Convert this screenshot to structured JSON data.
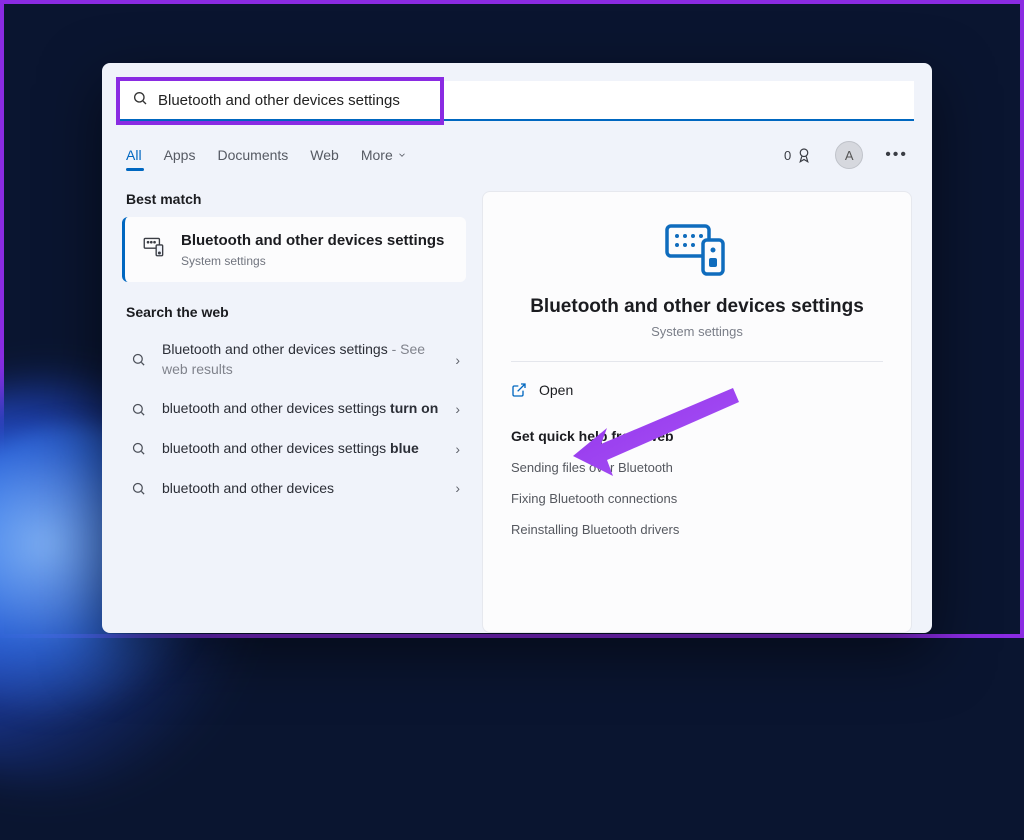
{
  "search": {
    "query": "Bluetooth and other devices settings"
  },
  "tabs": {
    "all": "All",
    "apps": "Apps",
    "documents": "Documents",
    "web": "Web",
    "more": "More"
  },
  "toolbar": {
    "rewards_points": "0",
    "avatar_initial": "A"
  },
  "sections": {
    "best_match": "Best match",
    "search_web": "Search the web"
  },
  "best_match": {
    "title": "Bluetooth and other devices settings",
    "subtitle": "System settings"
  },
  "web_results": [
    {
      "prefix": "Bluetooth and other devices settings",
      "suffix": " - See web results",
      "bold": ""
    },
    {
      "prefix": "bluetooth and other devices settings ",
      "bold": "turn on",
      "suffix": ""
    },
    {
      "prefix": "bluetooth and other devices settings ",
      "bold": "blue",
      "suffix": ""
    },
    {
      "prefix": "bluetooth and other devices",
      "bold": "",
      "suffix": ""
    }
  ],
  "detail": {
    "title": "Bluetooth and other devices settings",
    "subtitle": "System settings",
    "open_label": "Open",
    "quick_help_heading": "Get quick help from web",
    "help_links": [
      "Sending files over Bluetooth",
      "Fixing Bluetooth connections",
      "Reinstalling Bluetooth drivers"
    ]
  }
}
